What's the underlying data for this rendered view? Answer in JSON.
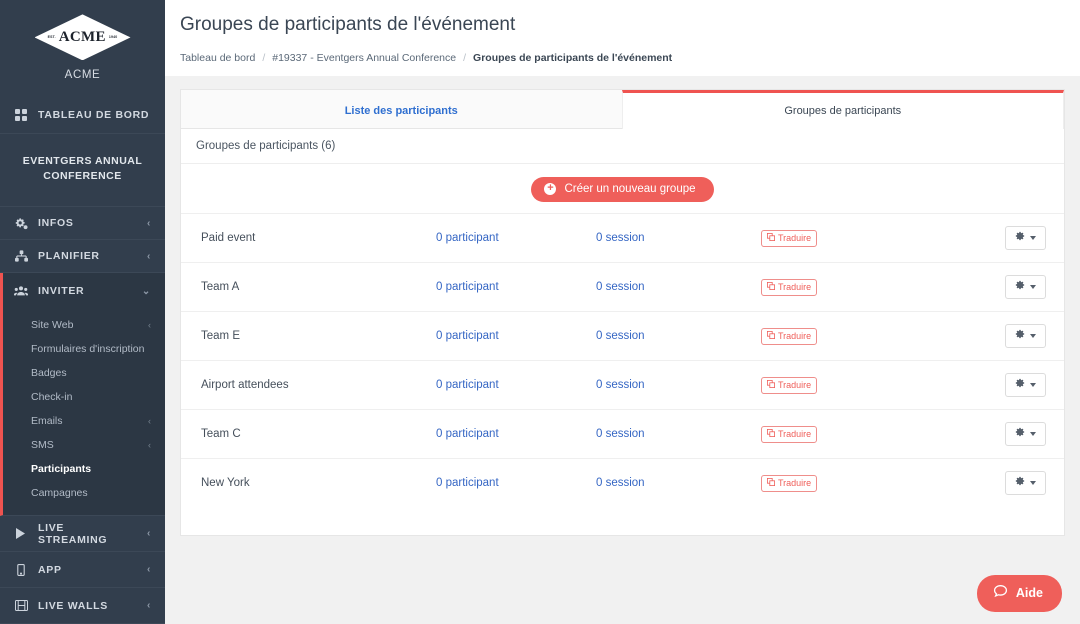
{
  "sidebar": {
    "logo": {
      "name": "ACME",
      "est": "EST.",
      "year": "1940",
      "icon": "acme-diamond-logo"
    },
    "brand": "ACME",
    "dashboard": {
      "label": "TABLEAU DE BORD",
      "icon": "grid-icon"
    },
    "event_title": "EVENTGERS ANNUAL CONFERENCE",
    "sections": [
      {
        "label": "INFOS",
        "icon": "gears-icon",
        "chevron": "‹"
      },
      {
        "label": "PLANIFIER",
        "icon": "sitemap-icon",
        "chevron": "‹"
      }
    ],
    "active_section": {
      "label": "INVITER",
      "icon": "users-icon",
      "chevron": "⌄"
    },
    "sub_items": [
      {
        "label": "Site Web",
        "chevron": "‹",
        "active": false
      },
      {
        "label": "Formulaires d'inscription",
        "chevron": "",
        "active": false
      },
      {
        "label": "Badges",
        "chevron": "",
        "active": false
      },
      {
        "label": "Check-in",
        "chevron": "",
        "active": false
      },
      {
        "label": "Emails",
        "chevron": "‹",
        "active": false
      },
      {
        "label": "SMS",
        "chevron": "‹",
        "active": false
      },
      {
        "label": "Participants",
        "chevron": "",
        "active": true
      },
      {
        "label": "Campagnes",
        "chevron": "",
        "active": false
      }
    ],
    "bottom_sections": [
      {
        "label": "LIVE STREAMING",
        "icon": "play-icon",
        "chevron": "‹"
      },
      {
        "label": "APP",
        "icon": "mobile-icon",
        "chevron": "‹"
      },
      {
        "label": "LIVE WALLS",
        "icon": "film-icon",
        "chevron": "‹"
      }
    ]
  },
  "header": {
    "title": "Groupes de participants de l'événement",
    "breadcrumb": [
      "Tableau de bord",
      "#19337 - Eventgers Annual Conference",
      "Groupes de participants de l'événement"
    ],
    "separator": "/"
  },
  "tabs": [
    {
      "label": "Liste des participants",
      "active": false
    },
    {
      "label": "Groupes de participants",
      "active": true
    }
  ],
  "main": {
    "section_title": "Groupes de participants (6)",
    "create_button": {
      "label": "Créer un nouveau groupe",
      "icon": "plus-circle-icon"
    },
    "badge_label": "Traduire",
    "badge_icon": "translate-icon",
    "gear_icon": "gear-icon",
    "rows": [
      {
        "name": "Paid event",
        "participants": "0 participant",
        "sessions": "0 session"
      },
      {
        "name": "Team A",
        "participants": "0 participant",
        "sessions": "0 session"
      },
      {
        "name": "Team E",
        "participants": "0 participant",
        "sessions": "0 session"
      },
      {
        "name": "Airport attendees",
        "participants": "0 participant",
        "sessions": "0 session"
      },
      {
        "name": "Team C",
        "participants": "0 participant",
        "sessions": "0 session"
      },
      {
        "name": "New York",
        "participants": "0 participant",
        "sessions": "0 session"
      }
    ]
  },
  "help": {
    "label": "Aide",
    "icon": "chat-bubble-icon"
  },
  "colors": {
    "sidebar_bg": "#323e4d",
    "accent_red": "#ef5f5a",
    "link_blue": "#3566c4",
    "page_bg": "#f1f1f1"
  }
}
